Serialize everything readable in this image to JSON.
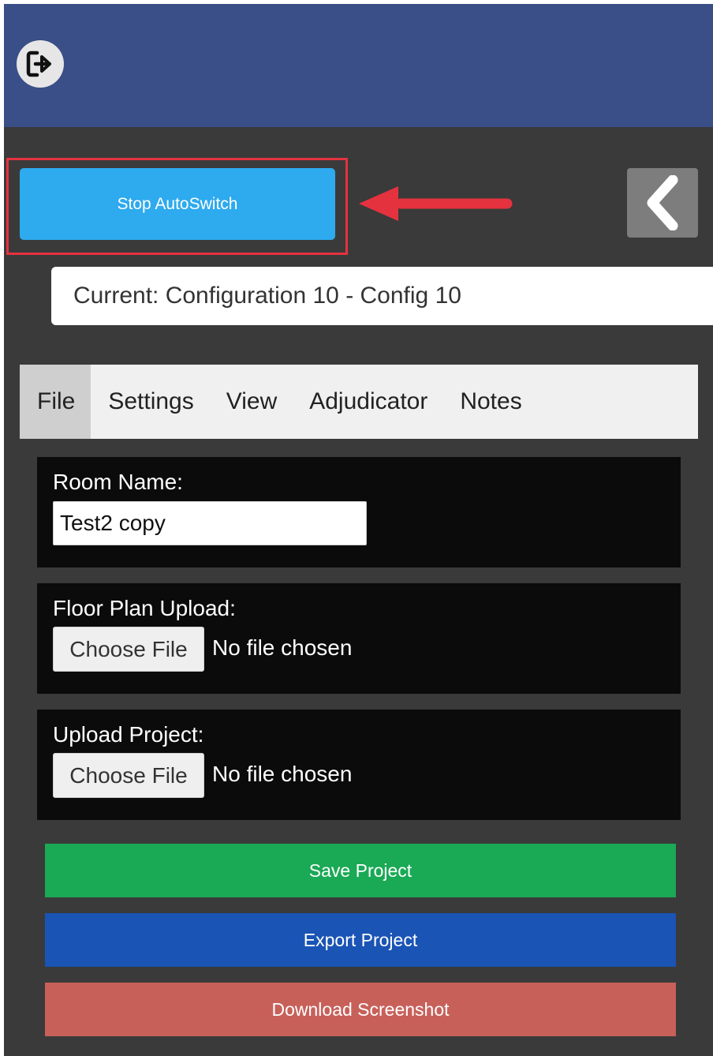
{
  "header": {
    "logout_icon": "logout-icon",
    "color": "#3a4e87"
  },
  "toolbar": {
    "autoswitch_label": "Stop AutoSwitch",
    "collapse_icon": "chevron-left-icon"
  },
  "current": {
    "text": "Current: Configuration 10 - Config 10"
  },
  "tabs": [
    {
      "label": "File",
      "active": true
    },
    {
      "label": "Settings",
      "active": false
    },
    {
      "label": "View",
      "active": false
    },
    {
      "label": "Adjudicator",
      "active": false
    },
    {
      "label": "Notes",
      "active": false
    }
  ],
  "file_panel": {
    "room_name_label": "Room Name:",
    "room_name_value": "Test2 copy",
    "floor_plan_label": "Floor Plan Upload:",
    "floor_plan_button": "Choose File",
    "floor_plan_status": "No file chosen",
    "upload_project_label": "Upload Project:",
    "upload_project_button": "Choose File",
    "upload_project_status": "No file chosen"
  },
  "actions": {
    "save_label": "Save Project",
    "export_label": "Export Project",
    "download_label": "Download Screenshot"
  },
  "colors": {
    "autoswitch": "#2eaaee",
    "annotation": "#e5323f",
    "save": "#1aa955",
    "export": "#1a54b5",
    "download": "#c8605a"
  }
}
